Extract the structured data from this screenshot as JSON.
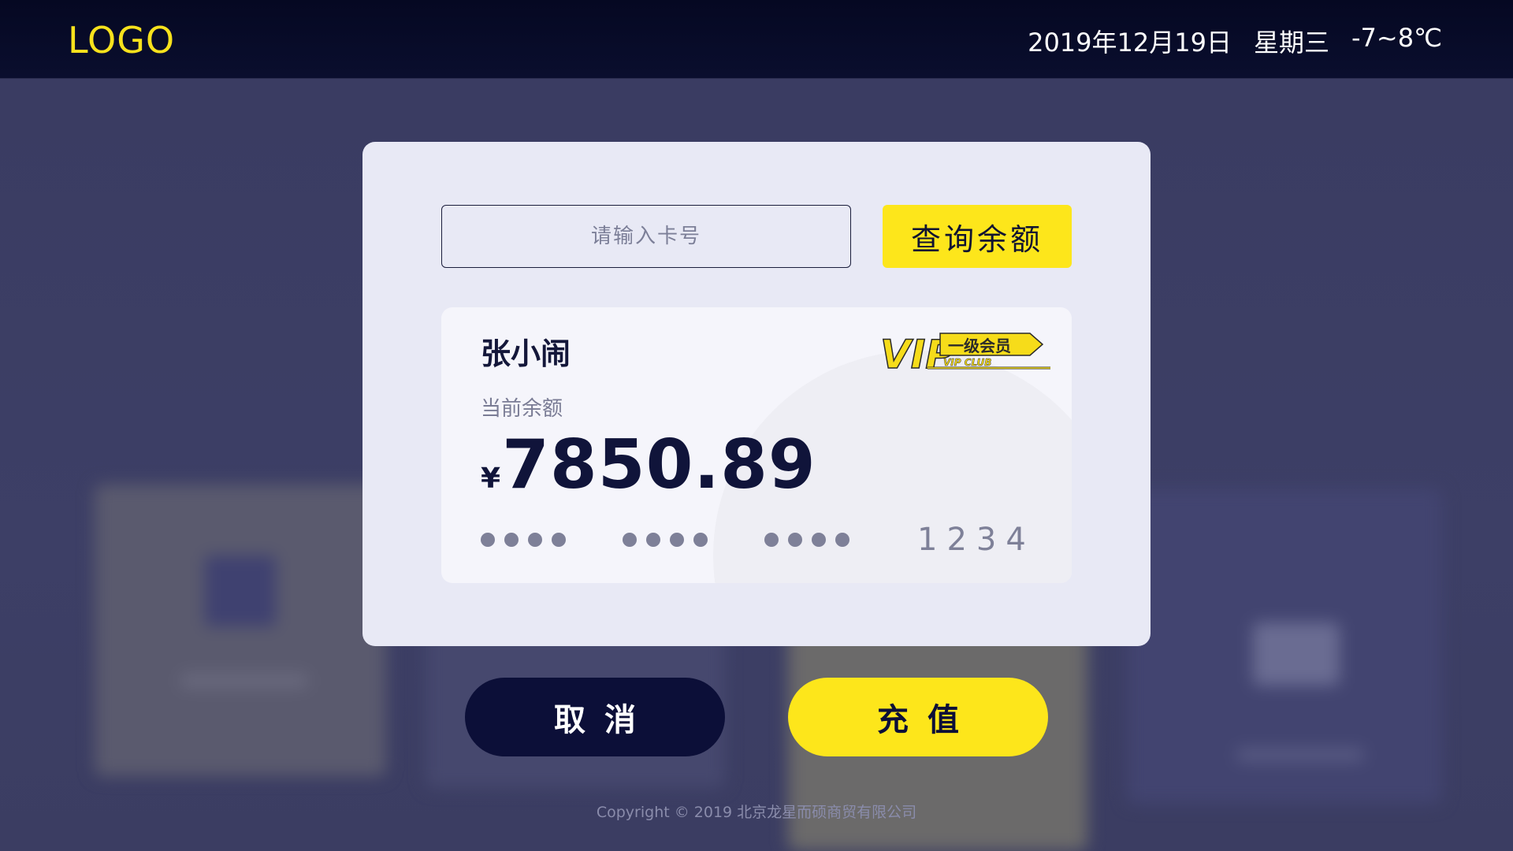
{
  "header": {
    "logo": "LOGO",
    "date": "2019年12月19日",
    "weekday": "星期三",
    "temperature": "-7~8℃"
  },
  "query": {
    "placeholder": "请输入卡号",
    "button_label": "查询余额"
  },
  "member_card": {
    "name": "张小闹",
    "vip_badge": {
      "big_text": "VIP",
      "level": "一级会员",
      "club": "VIP CLUB"
    },
    "balance_label": "当前余额",
    "currency": "¥",
    "balance": "7850.89",
    "masked_digits": [
      "●●●●",
      "●●●●",
      "●●●●"
    ],
    "last_digits": "1234"
  },
  "actions": {
    "cancel_label": "取消",
    "recharge_label": "充值"
  },
  "footer": {
    "copyright": "Copyright © 2019  北京龙星而硕商贸有限公司"
  },
  "colors": {
    "accent_yellow": "#fde61b",
    "navy": "#0c0f38",
    "dialog_bg": "#e8e9f5"
  }
}
